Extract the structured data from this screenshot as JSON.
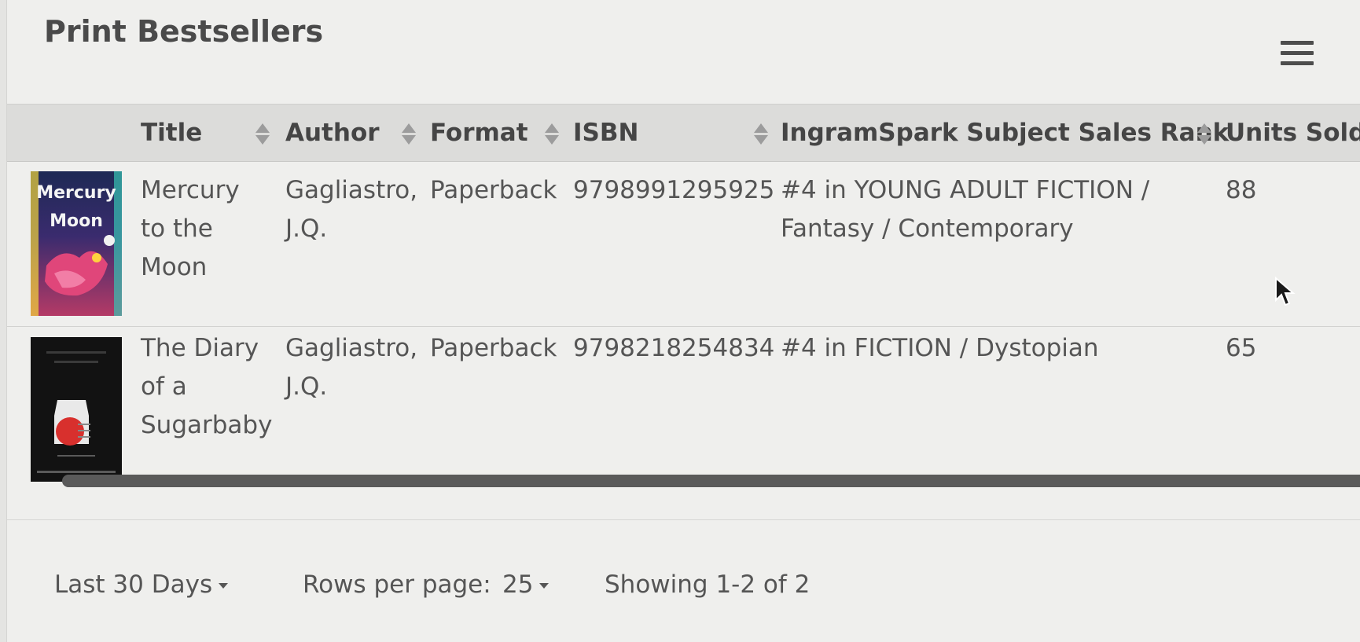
{
  "header": {
    "title": "Print Bestsellers",
    "menu_icon": "hamburger-icon"
  },
  "table": {
    "columns": [
      "Title",
      "Author",
      "Format",
      "ISBN",
      "IngramSpark Subject Sales Rank",
      "Units Sold"
    ],
    "rows": [
      {
        "cover_title": "Mercury",
        "cover_subtitle": "Moon",
        "title_lines": [
          "Mercury",
          "to the",
          "Moon"
        ],
        "author_lines": [
          "Gagliastro,",
          "J.Q."
        ],
        "format": "Paperback",
        "isbn": "9798991295925",
        "rank_lines": [
          "#4 in YOUNG ADULT FICTION /",
          "Fantasy / Contemporary"
        ],
        "units": "88"
      },
      {
        "title_lines": [
          "The Diary",
          "of a",
          "Sugarbaby"
        ],
        "author_lines": [
          "Gagliastro,",
          "J.Q."
        ],
        "format": "Paperback",
        "isbn": "9798218254834",
        "rank_lines": [
          "#4 in FICTION / Dystopian"
        ],
        "units": "65"
      }
    ]
  },
  "footer": {
    "date_range": "Last 30 Days",
    "rows_per_page_label": "Rows per page:",
    "rows_per_page_value": "25",
    "showing": "Showing 1-2 of 2"
  }
}
